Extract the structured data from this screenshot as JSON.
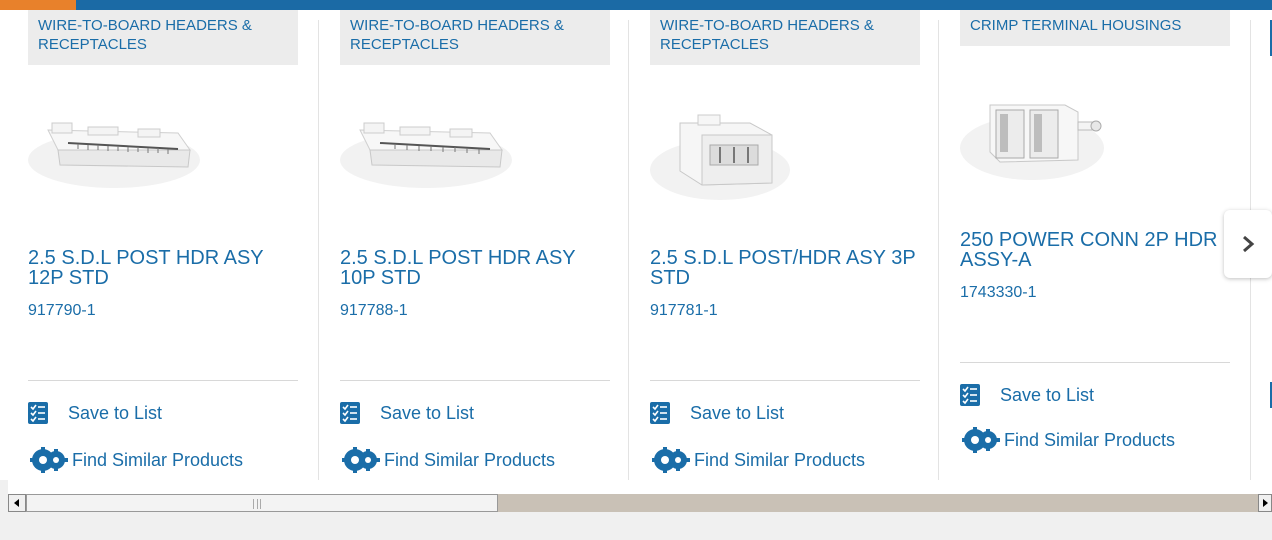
{
  "products": [
    {
      "category": "WIRE-TO-BOARD HEADERS & RECEPTACLES",
      "title": "2.5 S.D.L POST HDR ASY 12P STD",
      "part_number": "917790-1",
      "image_icon": "header-12p-connector-image",
      "save_label": "Save to List",
      "find_label": "Find Similar Products"
    },
    {
      "category": "WIRE-TO-BOARD HEADERS & RECEPTACLES",
      "title": "2.5 S.D.L POST HDR ASY 10P STD",
      "part_number": "917788-1",
      "image_icon": "header-10p-connector-image",
      "save_label": "Save to List",
      "find_label": "Find Similar Products"
    },
    {
      "category": "WIRE-TO-BOARD HEADERS & RECEPTACLES",
      "title": "2.5 S.D.L POST/HDR ASY 3P STD",
      "part_number": "917781-1",
      "image_icon": "header-3p-connector-image",
      "save_label": "Save to List",
      "find_label": "Find Similar Products"
    },
    {
      "category": "CRIMP TERMINAL HOUSINGS",
      "title": "250 POWER CONN 2P HDR ASSY-A",
      "part_number": "1743330-1",
      "image_icon": "power-conn-2p-housing-image",
      "save_label": "Save to List",
      "find_label": "Find Similar Products"
    }
  ],
  "carousel": {
    "next_icon": "chevron-right-icon"
  },
  "colors": {
    "link": "#1a6da8",
    "topbar": "#1b6aa5",
    "accent": "#e8812b",
    "category_bg": "#ececec"
  }
}
